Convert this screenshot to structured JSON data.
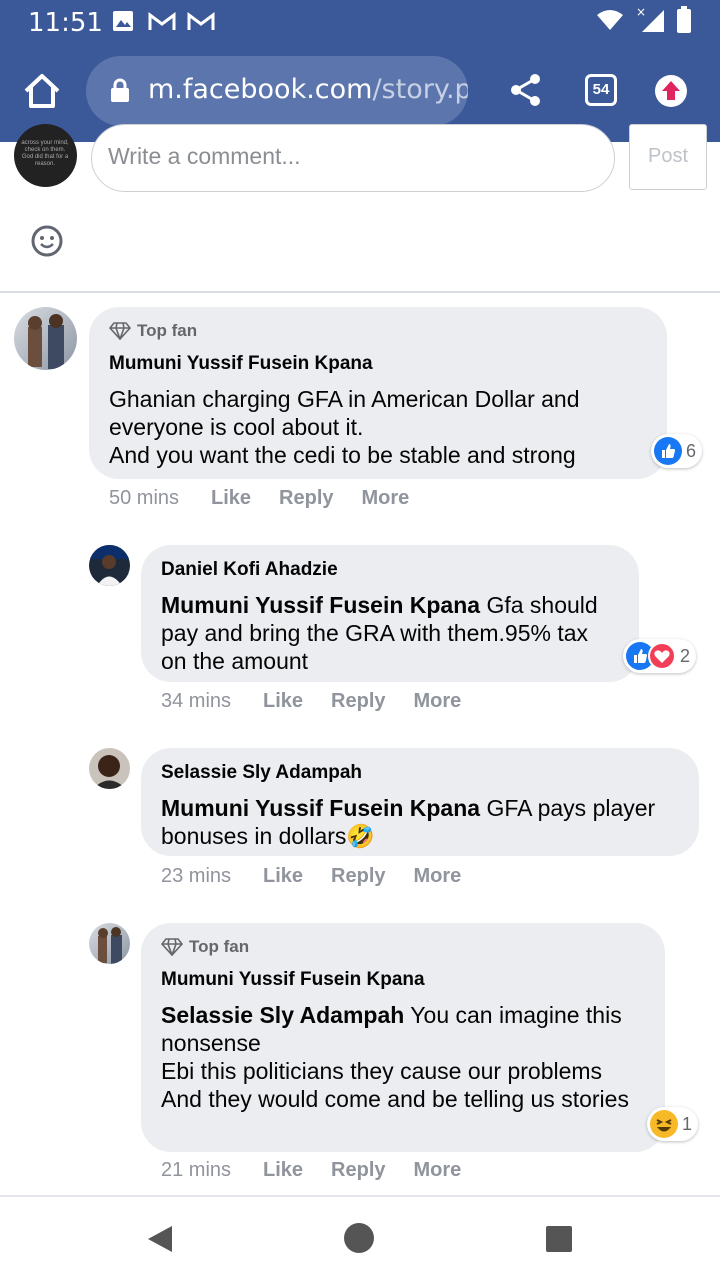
{
  "status_bar": {
    "time": "11:51",
    "icons": [
      "gallery-icon",
      "gmail-icon",
      "gmail-icon",
      "wifi-icon",
      "signal-icon",
      "battery-icon"
    ]
  },
  "browser": {
    "url_host": "m.facebook.com",
    "url_path": "/story.p",
    "tab_count": "54"
  },
  "composer": {
    "placeholder": "Write a comment...",
    "post_label": "Post",
    "avatar_text": "across your mind, check on them. God did that for a reason."
  },
  "comments": [
    {
      "top_fan": "Top fan",
      "author": "Mumuni Yussif Fusein Kpana",
      "mention": "",
      "text": "Ghanian charging GFA in American Dollar and everyone is cool about it.\nAnd you want the cedi to be stable and strong",
      "time": "50 mins",
      "like": "Like",
      "reply": "Reply",
      "more": "More",
      "reaction_count": "6"
    },
    {
      "top_fan": "",
      "author": "Daniel Kofi Ahadzie",
      "mention": "Mumuni Yussif Fusein Kpana",
      "text": " Gfa should pay and bring the GRA with them.95% tax on the amount",
      "time": "34 mins",
      "like": "Like",
      "reply": "Reply",
      "more": "More",
      "reaction_count": "2"
    },
    {
      "top_fan": "",
      "author": "Selassie Sly Adampah",
      "mention": "Mumuni Yussif Fusein Kpana",
      "text": " GFA pays player bonuses in dollars🤣",
      "time": "23 mins",
      "like": "Like",
      "reply": "Reply",
      "more": "More",
      "reaction_count": ""
    },
    {
      "top_fan": "Top fan",
      "author": "Mumuni Yussif Fusein Kpana",
      "mention": "Selassie Sly Adampah",
      "text": " You can imagine this nonsense\nEbi this politicians they cause our problems\nAnd they would come and be telling us stories",
      "time": "21 mins",
      "like": "Like",
      "reply": "Reply",
      "more": "More",
      "reaction_count": "1"
    }
  ],
  "colors": {
    "brand": "#3b5998",
    "bubble": "#ebedf0",
    "like_blue": "#1877f2"
  }
}
